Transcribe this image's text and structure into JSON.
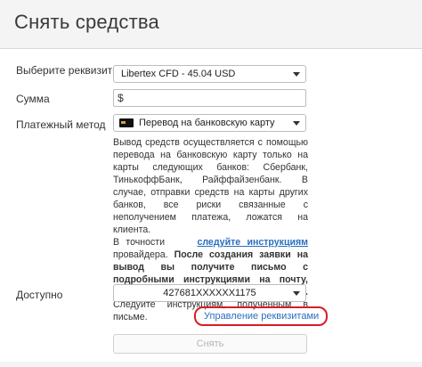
{
  "header": {
    "title": "Снять средства"
  },
  "form": {
    "requisites_label": "Выберите реквизиты",
    "requisites_value": "Libertex CFD - 45.04 USD",
    "amount_label": "Сумма",
    "amount_prefix": "$",
    "amount_value": "",
    "method_label": "Платежный метод",
    "method_value": "Перевод на банковскую карту",
    "method_icon": "bank-card-icon",
    "description": {
      "p1": "Вывод средств осуществляется с помощью перевода на банковскую карту только на карты следующих банков: Сбербанк, ТинькоффБанк, Райффайзенбанк. В случае, отправки средств на карты других банков, все риски связанные с неполучением платежа, ложатся на клиента.",
      "p2_pre": "В точности",
      "p2_link": "следуйте инструкциям",
      "p2_post": "провайдера.",
      "p2_bold": "После создания заявки на вывод вы получите письмо с подробными инструкциями на почту, привязанную к аккаунту Libertex.",
      "p2_end": "Следуйте инструкциям, полученным в письме."
    },
    "available_label": "Доступно",
    "available_value": "427681XXXXXX1175",
    "manage_link": "Управление реквизитами",
    "submit_label": "Снять"
  },
  "colors": {
    "link": "#2a6fbe",
    "highlight": "#d81c27",
    "header_bg": "#f4f4f4"
  }
}
